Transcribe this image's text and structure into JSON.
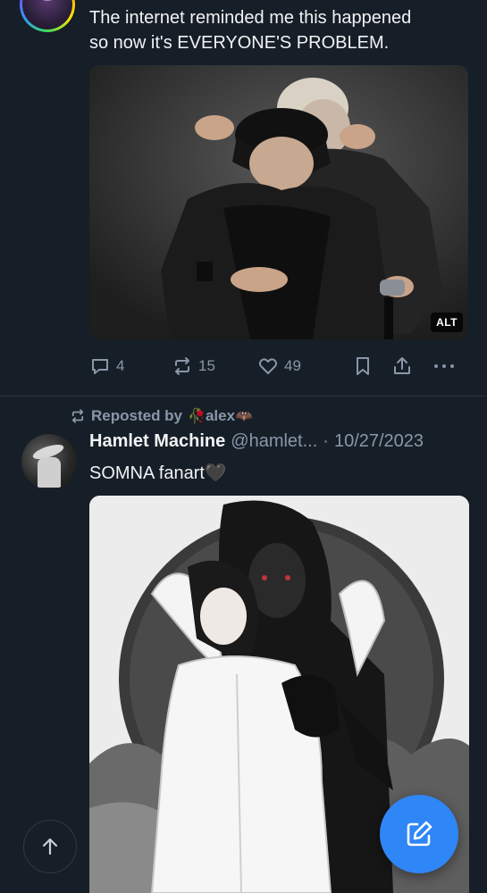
{
  "post1": {
    "text_line1": "The internet reminded me this happened",
    "text_line2": "so now it's EVERYONE'S PROBLEM.",
    "image_alt_badge": "ALT",
    "replies": "4",
    "reposts": "15",
    "likes": "49"
  },
  "post2": {
    "repost_label": "Reposted by",
    "repost_emoji_before": "🥀",
    "reposter": "alex",
    "repost_emoji_after": "🦇",
    "author_name": "Hamlet Machine",
    "author_handle": "@hamlet...",
    "separator": "·",
    "date": "10/27/2023",
    "text": "SOMNA fanart🖤"
  },
  "colors": {
    "background": "#161e27",
    "muted": "#8a97a8",
    "accent": "#2f86f6"
  },
  "icons": [
    "reply-icon",
    "repost-icon",
    "like-icon",
    "bookmark-icon",
    "share-icon",
    "more-icon",
    "scroll-top-icon",
    "compose-icon"
  ]
}
